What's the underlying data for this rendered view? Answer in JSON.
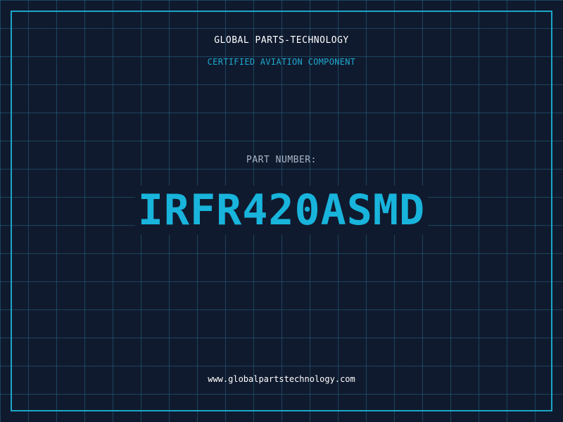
{
  "header": {
    "company_name": "GLOBAL PARTS-TECHNOLOGY",
    "tagline": "CERTIFIED AVIATION COMPONENT"
  },
  "part": {
    "label": "PART NUMBER:",
    "number": "IRFR420ASMD"
  },
  "footer": {
    "url": "www.globalpartstechnology.com"
  },
  "colors": {
    "background": "#101a2e",
    "grid": "#28789a",
    "accent": "#1aa6c8",
    "part_number": "#18b4dc",
    "label": "#a9b8c8",
    "text": "#ffffff"
  }
}
